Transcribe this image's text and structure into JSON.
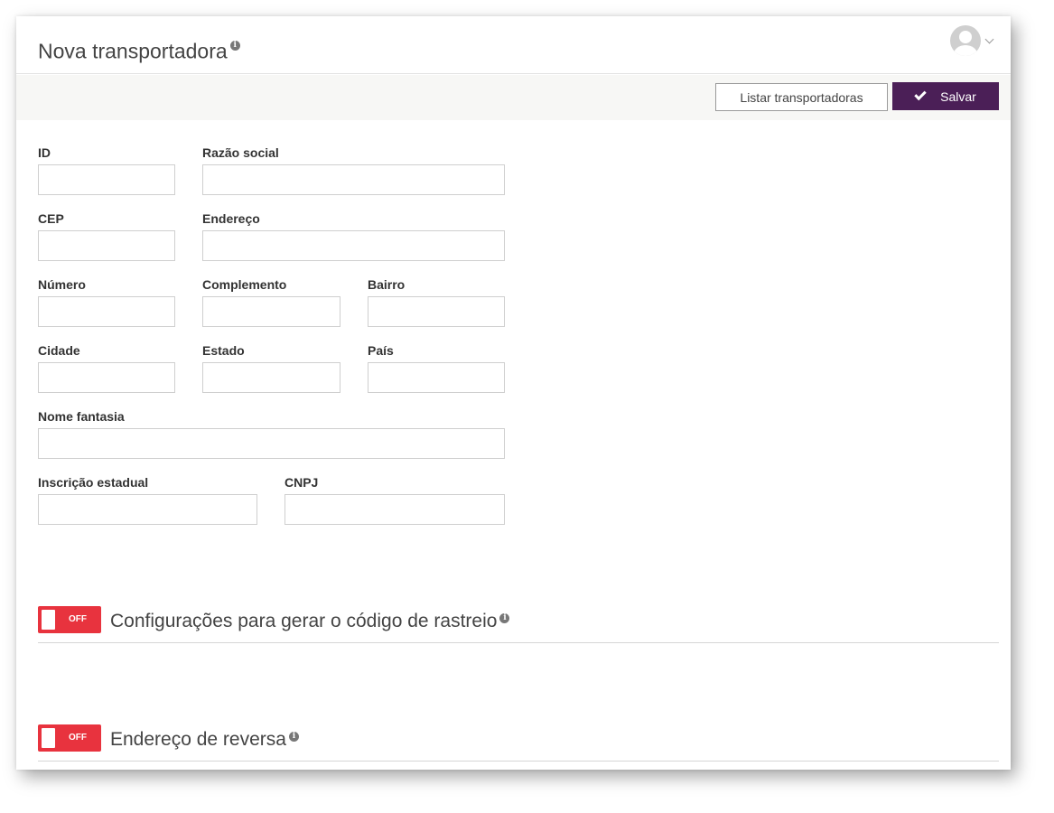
{
  "header": {
    "title": "Nova transportadora",
    "title_info_icon": "info-icon",
    "avatar_icon": "user-avatar-icon",
    "menu_icon": "chevron-down-icon"
  },
  "toolbar": {
    "list_label": "Listar transportadoras",
    "save_label": "Salvar",
    "save_icon": "check-icon",
    "save_color": "#4b1f57"
  },
  "form": {
    "id": {
      "label": "ID",
      "value": ""
    },
    "razao_social": {
      "label": "Razão social",
      "value": ""
    },
    "cep": {
      "label": "CEP",
      "value": ""
    },
    "endereco": {
      "label": "Endereço",
      "value": ""
    },
    "numero": {
      "label": "Número",
      "value": ""
    },
    "complemento": {
      "label": "Complemento",
      "value": ""
    },
    "bairro": {
      "label": "Bairro",
      "value": ""
    },
    "cidade": {
      "label": "Cidade",
      "value": ""
    },
    "estado": {
      "label": "Estado",
      "value": ""
    },
    "pais": {
      "label": "País",
      "value": ""
    },
    "nome_fantasia": {
      "label": "Nome fantasia",
      "value": ""
    },
    "inscricao_estadual": {
      "label": "Inscrição estadual",
      "value": ""
    },
    "cnpj": {
      "label": "CNPJ",
      "value": ""
    }
  },
  "sections": [
    {
      "title": "Configurações para gerar o código de rastreio",
      "toggle_label": "OFF",
      "enabled": false
    },
    {
      "title": "Endereço de reversa",
      "toggle_label": "OFF",
      "enabled": false
    }
  ],
  "colors": {
    "toggle_off": "#e8333e",
    "brand": "#4b1f57"
  }
}
